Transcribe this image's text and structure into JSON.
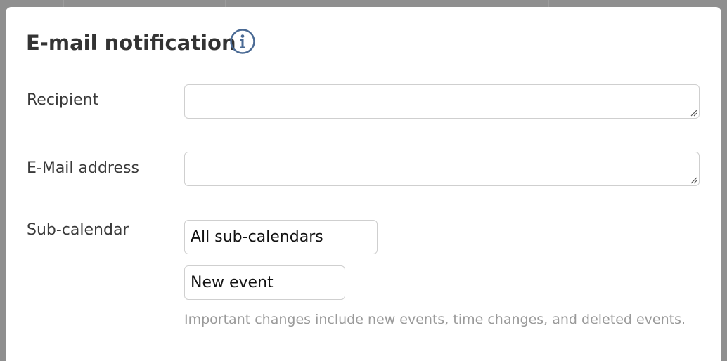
{
  "dialog": {
    "title": "E-mail notification",
    "info_icon": "info-circle-icon",
    "accent_color": "#4a6a94"
  },
  "form": {
    "recipient": {
      "label": "Recipient",
      "value": ""
    },
    "email": {
      "label": "E-Mail address",
      "value": ""
    },
    "subcalendar": {
      "label": "Sub-calendar",
      "selected": "All sub-calendars",
      "trigger_selected": "New event",
      "help": "Important changes include new events, time changes, and deleted events."
    }
  }
}
